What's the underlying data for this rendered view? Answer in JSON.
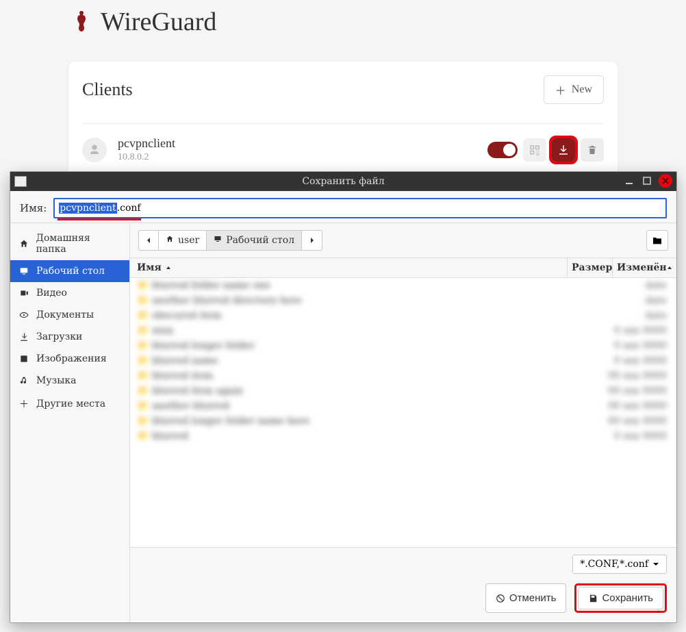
{
  "app": {
    "title": "WireGuard"
  },
  "clients": {
    "heading": "Clients",
    "new_label": "New",
    "items": [
      {
        "name": "pcvpnclient",
        "ip": "10.8.0.2"
      }
    ]
  },
  "dialog": {
    "title": "Сохранить файл",
    "name_label": "Имя:",
    "filename_selected": "pcvpnclient",
    "filename_rest": ".conf",
    "sidebar": [
      {
        "icon": "home",
        "label": "Домашняя папка"
      },
      {
        "icon": "monitor",
        "label": "Рабочий стол"
      },
      {
        "icon": "video",
        "label": "Видео"
      },
      {
        "icon": "eye",
        "label": "Документы"
      },
      {
        "icon": "download",
        "label": "Загрузки"
      },
      {
        "icon": "image",
        "label": "Изображения"
      },
      {
        "icon": "music",
        "label": "Музыка"
      },
      {
        "icon": "plus",
        "label": "Другие места"
      }
    ],
    "path": {
      "user": "user",
      "current": "Рабочий стол"
    },
    "columns": {
      "name": "Имя",
      "size": "Размер",
      "modified": "Изменён"
    },
    "filter": "*.CONF,*.conf",
    "cancel": "Отменить",
    "save": "Сохранить"
  }
}
